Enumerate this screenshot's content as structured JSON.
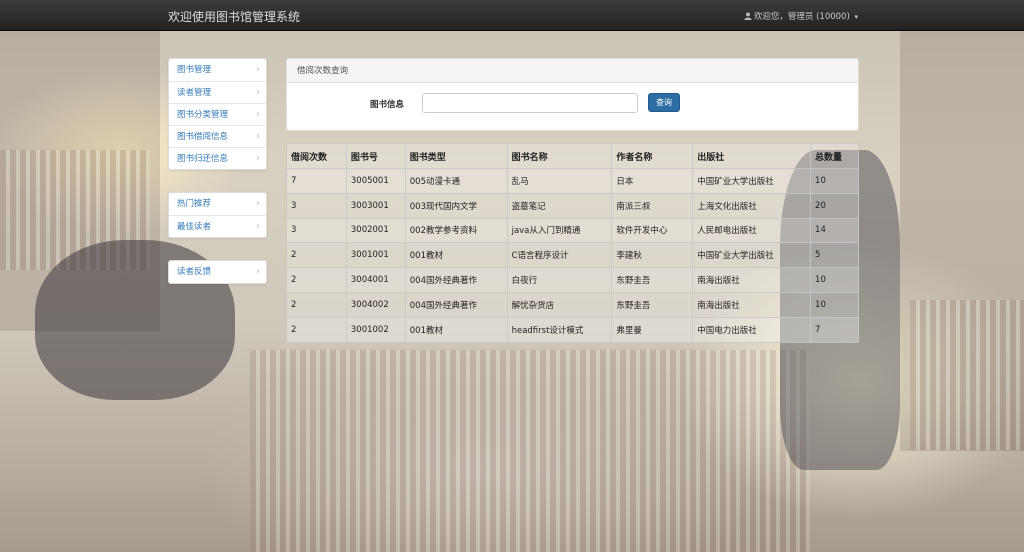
{
  "header": {
    "brand": "欢迎使用图书馆管理系统",
    "user_text": "欢迎您，管理员 (10000)",
    "caret": "▾"
  },
  "sidebar": {
    "group1": [
      {
        "label": "图书管理"
      },
      {
        "label": "读者管理"
      },
      {
        "label": "图书分类管理"
      },
      {
        "label": "图书借阅信息"
      },
      {
        "label": "图书归还信息"
      }
    ],
    "group2": [
      {
        "label": "热门推荐"
      },
      {
        "label": "最佳读者"
      }
    ],
    "group3": [
      {
        "label": "读者反馈"
      }
    ],
    "chevron": "›"
  },
  "query_panel": {
    "title": "借阅次数查询",
    "field_label": "图书信息",
    "input_value": "",
    "button_label": "查询"
  },
  "table": {
    "headers": [
      "借阅次数",
      "图书号",
      "图书类型",
      "图书名称",
      "作者名称",
      "出版社",
      "总数量"
    ],
    "rows": [
      [
        "7",
        "3005001",
        "005动漫卡通",
        "乱马",
        "日本",
        "中国矿业大学出版社",
        "10"
      ],
      [
        "3",
        "3003001",
        "003现代国内文学",
        "盗墓笔记",
        "南派三叔",
        "上海文化出版社",
        "20"
      ],
      [
        "3",
        "3002001",
        "002教学参考资料",
        "java从入门到精通",
        "软件开发中心",
        "人民邮电出版社",
        "14"
      ],
      [
        "2",
        "3001001",
        "001教材",
        "C语言程序设计",
        "李建秋",
        "中国矿业大学出版社",
        "5"
      ],
      [
        "2",
        "3004001",
        "004国外经典著作",
        "白夜行",
        "东野圭吾",
        "南海出版社",
        "10"
      ],
      [
        "2",
        "3004002",
        "004国外经典著作",
        "解忧杂货店",
        "东野圭吾",
        "南海出版社",
        "10"
      ],
      [
        "2",
        "3001002",
        "001教材",
        "headfirst设计模式",
        "弗里曼",
        "中国电力出版社",
        "7"
      ]
    ]
  },
  "colors": {
    "navbar": "#222222",
    "link": "#337ab7",
    "primary_button": "#2e6da4"
  }
}
